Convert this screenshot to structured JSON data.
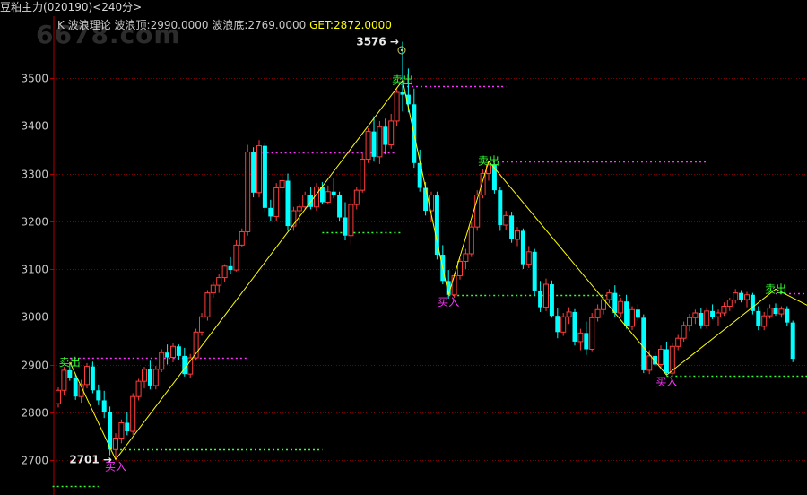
{
  "window": {
    "title": "豆粕主力",
    "code": "(020190)",
    "period": "<240分>"
  },
  "indicator": {
    "k_label": "K",
    "name": "波浪理论",
    "peak_label": "波浪顶:",
    "peak_value": "2990.0000",
    "trough_label": "波浪底:",
    "trough_value": "2769.0000",
    "get_label": "GET:",
    "get_value": "2872.0000"
  },
  "watermark": "6678.com",
  "colors": {
    "up": "#ff3c3c",
    "down": "#00ffff",
    "sell": "#33ff33",
    "buy": "#ff33ff",
    "wave_line": "#ffff00",
    "resistance": "#ff33ff",
    "support": "#33ff33",
    "grid": "#7a0000"
  },
  "chart_data": {
    "type": "candlestick",
    "yaxis": {
      "ticks": [
        2700,
        2800,
        2900,
        3000,
        3100,
        3200,
        3300,
        3400,
        3500
      ],
      "tick_labels": [
        "2700",
        "2800",
        "2900",
        "3000",
        "3100",
        "3200",
        "3300",
        "3400",
        "3500"
      ]
    },
    "annotations": {
      "high_label": "3576",
      "high_arrow": "→",
      "low_label": "2701",
      "low_arrow": "→",
      "sell_text": "卖出",
      "buy_text": "买入"
    },
    "candles": [
      [
        2818,
        2852,
        2810,
        2846
      ],
      [
        2846,
        2895,
        2835,
        2888
      ],
      [
        2888,
        2905,
        2866,
        2872
      ],
      [
        2872,
        2881,
        2826,
        2833
      ],
      [
        2833,
        2868,
        2820,
        2858
      ],
      [
        2858,
        2903,
        2850,
        2896
      ],
      [
        2896,
        2906,
        2840,
        2846
      ],
      [
        2846,
        2858,
        2815,
        2825
      ],
      [
        2825,
        2845,
        2788,
        2800
      ],
      [
        2800,
        2812,
        2710,
        2722
      ],
      [
        2722,
        2756,
        2701,
        2746
      ],
      [
        2746,
        2785,
        2735,
        2778
      ],
      [
        2778,
        2801,
        2752,
        2760
      ],
      [
        2760,
        2840,
        2752,
        2833
      ],
      [
        2833,
        2870,
        2825,
        2865
      ],
      [
        2865,
        2895,
        2850,
        2890
      ],
      [
        2890,
        2908,
        2848,
        2856
      ],
      [
        2856,
        2897,
        2848,
        2890
      ],
      [
        2890,
        2932,
        2884,
        2925
      ],
      [
        2925,
        2942,
        2900,
        2915
      ],
      [
        2915,
        2945,
        2905,
        2938
      ],
      [
        2938,
        2942,
        2910,
        2918
      ],
      [
        2918,
        2935,
        2875,
        2880
      ],
      [
        2880,
        2922,
        2872,
        2914
      ],
      [
        2914,
        2975,
        2908,
        2968
      ],
      [
        2968,
        3008,
        2960,
        3000
      ],
      [
        3000,
        3056,
        2992,
        3050
      ],
      [
        3050,
        3072,
        3040,
        3066
      ],
      [
        3066,
        3090,
        3050,
        3082
      ],
      [
        3082,
        3110,
        3072,
        3106
      ],
      [
        3106,
        3125,
        3090,
        3098
      ],
      [
        3098,
        3160,
        3095,
        3150
      ],
      [
        3150,
        3185,
        3145,
        3178
      ],
      [
        3178,
        3360,
        3170,
        3345
      ],
      [
        3345,
        3355,
        3250,
        3260
      ],
      [
        3260,
        3370,
        3250,
        3358
      ],
      [
        3358,
        3365,
        3220,
        3228
      ],
      [
        3228,
        3245,
        3200,
        3210
      ],
      [
        3210,
        3280,
        3200,
        3270
      ],
      [
        3270,
        3295,
        3260,
        3285
      ],
      [
        3285,
        3300,
        3180,
        3190
      ],
      [
        3190,
        3230,
        3180,
        3222
      ],
      [
        3222,
        3235,
        3195,
        3230
      ],
      [
        3230,
        3262,
        3225,
        3255
      ],
      [
        3255,
        3272,
        3225,
        3230
      ],
      [
        3230,
        3280,
        3222,
        3272
      ],
      [
        3272,
        3282,
        3235,
        3240
      ],
      [
        3240,
        3275,
        3235,
        3262
      ],
      [
        3262,
        3290,
        3248,
        3255
      ],
      [
        3255,
        3262,
        3200,
        3208
      ],
      [
        3208,
        3240,
        3160,
        3170
      ],
      [
        3170,
        3250,
        3150,
        3235
      ],
      [
        3235,
        3272,
        3225,
        3265
      ],
      [
        3265,
        3342,
        3260,
        3330
      ],
      [
        3330,
        3395,
        3322,
        3388
      ],
      [
        3388,
        3420,
        3325,
        3335
      ],
      [
        3335,
        3410,
        3320,
        3398
      ],
      [
        3398,
        3415,
        3340,
        3360
      ],
      [
        3360,
        3425,
        3352,
        3410
      ],
      [
        3410,
        3480,
        3400,
        3470
      ],
      [
        3470,
        3576,
        3430,
        3465
      ],
      [
        3465,
        3520,
        3428,
        3445
      ],
      [
        3445,
        3478,
        3312,
        3322
      ],
      [
        3322,
        3350,
        3262,
        3270
      ],
      [
        3270,
        3282,
        3212,
        3222
      ],
      [
        3222,
        3262,
        3198,
        3255
      ],
      [
        3255,
        3262,
        3120,
        3130
      ],
      [
        3130,
        3150,
        3068,
        3075
      ],
      [
        3075,
        3098,
        3038,
        3046
      ],
      [
        3046,
        3092,
        3040,
        3086
      ],
      [
        3086,
        3122,
        3078,
        3116
      ],
      [
        3116,
        3142,
        3100,
        3132
      ],
      [
        3132,
        3198,
        3125,
        3188
      ],
      [
        3188,
        3265,
        3180,
        3255
      ],
      [
        3255,
        3310,
        3248,
        3300
      ],
      [
        3300,
        3326,
        3285,
        3318
      ],
      [
        3318,
        3322,
        3258,
        3265
      ],
      [
        3265,
        3272,
        3180,
        3192
      ],
      [
        3192,
        3222,
        3182,
        3212
      ],
      [
        3212,
        3220,
        3155,
        3162
      ],
      [
        3162,
        3188,
        3148,
        3180
      ],
      [
        3180,
        3185,
        3100,
        3110
      ],
      [
        3110,
        3148,
        3102,
        3136
      ],
      [
        3136,
        3142,
        3045,
        3055
      ],
      [
        3055,
        3075,
        3010,
        3020
      ],
      [
        3020,
        3080,
        3012,
        3068
      ],
      [
        3068,
        3076,
        2998,
        3002
      ],
      [
        3002,
        3018,
        2955,
        2968
      ],
      [
        2968,
        3008,
        2960,
        3000
      ],
      [
        3000,
        3020,
        2985,
        3010
      ],
      [
        3010,
        3016,
        2940,
        2948
      ],
      [
        2948,
        2975,
        2930,
        2966
      ],
      [
        2966,
        2990,
        2920,
        2932
      ],
      [
        2932,
        3008,
        2928,
        2998
      ],
      [
        2998,
        3026,
        2990,
        3015
      ],
      [
        3015,
        3042,
        3005,
        3036
      ],
      [
        3036,
        3058,
        3028,
        3050
      ],
      [
        3050,
        3066,
        3000,
        3008
      ],
      [
        3008,
        3040,
        3000,
        3032
      ],
      [
        3032,
        3046,
        2975,
        2980
      ],
      [
        2980,
        3022,
        2972,
        3015
      ],
      [
        3015,
        3026,
        2990,
        2998
      ],
      [
        2998,
        3005,
        2882,
        2888
      ],
      [
        2888,
        2930,
        2880,
        2918
      ],
      [
        2918,
        2925,
        2895,
        2900
      ],
      [
        2900,
        2940,
        2893,
        2932
      ],
      [
        2932,
        2948,
        2878,
        2882
      ],
      [
        2882,
        2945,
        2876,
        2938
      ],
      [
        2938,
        2962,
        2930,
        2955
      ],
      [
        2955,
        2990,
        2948,
        2982
      ],
      [
        2982,
        3006,
        2970,
        2998
      ],
      [
        2998,
        3015,
        2985,
        3008
      ],
      [
        3008,
        3018,
        2975,
        2982
      ],
      [
        2982,
        3020,
        2975,
        3012
      ],
      [
        3012,
        3026,
        2995,
        3000
      ],
      [
        3000,
        3015,
        2982,
        3008
      ],
      [
        3008,
        3030,
        3002,
        3022
      ],
      [
        3022,
        3040,
        3012,
        3035
      ],
      [
        3035,
        3058,
        3028,
        3050
      ],
      [
        3050,
        3056,
        3030,
        3036
      ],
      [
        3036,
        3052,
        3020,
        3046
      ],
      [
        3046,
        3050,
        3005,
        3012
      ],
      [
        3012,
        3022,
        2972,
        2980
      ],
      [
        2980,
        3010,
        2972,
        3002
      ],
      [
        3002,
        3026,
        2996,
        3018
      ],
      [
        3018,
        3028,
        3002,
        3006
      ],
      [
        3006,
        3022,
        2998,
        3016
      ],
      [
        3016,
        3022,
        2980,
        2988
      ],
      [
        2988,
        2992,
        2905,
        2912
      ]
    ],
    "wave_points": [
      {
        "i": 2,
        "p": 2905
      },
      {
        "i": 10,
        "p": 2701
      },
      {
        "i": 60,
        "p": 3495
      },
      {
        "i": 68,
        "p": 3046
      },
      {
        "i": 75,
        "p": 3326
      },
      {
        "i": 106,
        "p": 2878
      },
      {
        "i": 125,
        "p": 3058
      },
      {
        "i": 136,
        "p": 2990
      }
    ],
    "sell_signals": [
      {
        "i": 2,
        "p": 2905
      },
      {
        "i": 60,
        "p": 3495
      },
      {
        "i": 75,
        "p": 3326
      },
      {
        "i": 125,
        "p": 3058
      }
    ],
    "buy_signals": [
      {
        "i": 10,
        "p": 2701
      },
      {
        "i": 68,
        "p": 3046
      },
      {
        "i": 106,
        "p": 2878
      }
    ],
    "resistance_lines": [
      {
        "i0": 2,
        "i1": 33,
        "p": 2915
      },
      {
        "i0": 34,
        "i1": 59,
        "p": 3345
      },
      {
        "i0": 60,
        "i1": 78,
        "p": 3483
      },
      {
        "i0": 75,
        "i1": 113,
        "p": 3325
      },
      {
        "i0": 125,
        "i1": 136,
        "p": 3050
      }
    ],
    "support_lines": [
      {
        "i0": -1,
        "i1": 7,
        "p": 2645
      },
      {
        "i0": 10,
        "i1": 46,
        "p": 2722
      },
      {
        "i0": 46,
        "i1": 60,
        "p": 3177
      },
      {
        "i0": 68,
        "i1": 98,
        "p": 3046
      },
      {
        "i0": 106,
        "i1": 136,
        "p": 2877
      }
    ]
  }
}
